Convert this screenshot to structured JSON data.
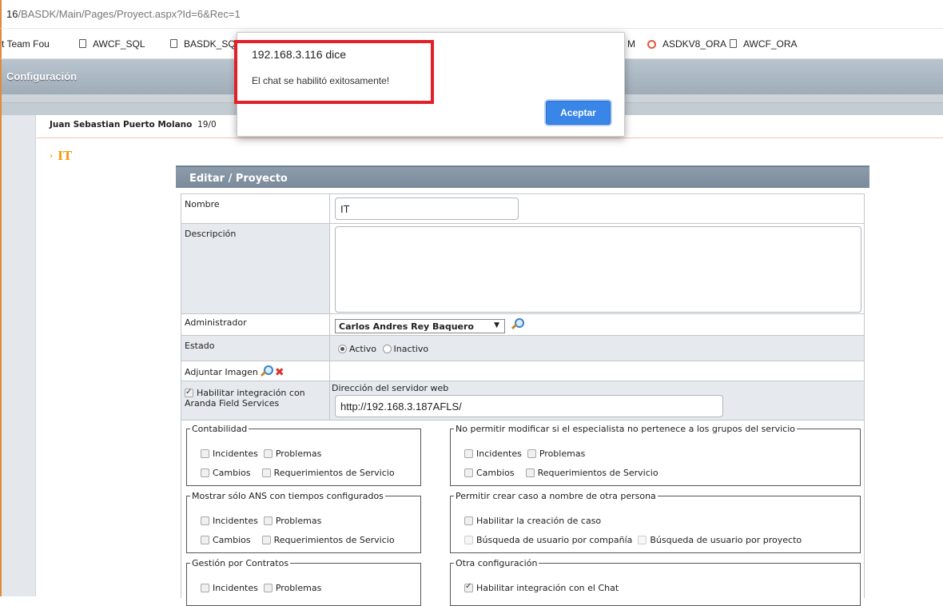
{
  "browser": {
    "url_host": "16",
    "url_path": "/BASDK/Main/Pages/Proyect.aspx?Id=6&Rec=1",
    "bookmarks": [
      {
        "label": "t Team Fou",
        "icon": "none"
      },
      {
        "label": "AWCF_SQL",
        "icon": "page-icon"
      },
      {
        "label": "BASDK_SQ",
        "icon": "page-icon"
      },
      {
        "label": "M",
        "icon": "none"
      },
      {
        "label": "ASDKV8_ORA",
        "icon": "target-icon"
      },
      {
        "label": "AWCF_ORA",
        "icon": "page-icon"
      }
    ]
  },
  "app": {
    "title": "Configuración",
    "user_name": "Juan Sebastian Puerto Molano",
    "user_date": "19/0",
    "section_title": "IT"
  },
  "form": {
    "panel_title": "Editar / Proyecto",
    "nombre_label": "Nombre",
    "nombre_value": "IT",
    "descripcion_label": "Descripción",
    "descripcion_value": "",
    "administrador_label": "Administrador",
    "administrador_value": "Carlos Andres Rey Baquero",
    "estado_label": "Estado",
    "estado_activo": "Activo",
    "estado_inactivo": "Inactivo",
    "adjuntar_label": "Adjuntar Imagen",
    "afs_label": "Habilitar integración con Aranda Field Services",
    "servidor_label": "Dirección del servidor web",
    "servidor_value": "http://192.168.3.187AFLS/",
    "groups": {
      "contabilidad": {
        "legend": "Contabilidad",
        "incidentes": "Incidentes",
        "problemas": "Problemas",
        "cambios": "Cambios",
        "requerimientos": "Requerimientos de Servicio"
      },
      "no_modificar": {
        "legend": "No permitir modificar si el especialista no pertenece a los grupos del servicio",
        "incidentes": "Incidentes",
        "problemas": "Problemas",
        "cambios": "Cambios",
        "requerimientos": "Requerimientos de Servicio"
      },
      "ans": {
        "legend": "Mostrar sólo ANS con tiempos configurados",
        "incidentes": "Incidentes",
        "problemas": "Problemas",
        "cambios": "Cambios",
        "requerimientos": "Requerimientos de Servicio"
      },
      "otra_persona": {
        "legend": "Permitir crear caso a nombre de otra persona",
        "habilitar": "Habilitar la creación de caso",
        "busq_compania": "Búsqueda de usuario por compañía",
        "busq_proyecto": "Búsqueda de usuario por proyecto"
      },
      "contratos": {
        "legend": "Gestión por Contratos",
        "incidentes": "Incidentes",
        "problemas": "Problemas"
      },
      "otra_config": {
        "legend": "Otra configuración",
        "chat": "Habilitar integración con el Chat"
      }
    }
  },
  "dialog": {
    "title": "192.168.3.116 dice",
    "message": "El chat se habilitó exitosamente!",
    "ok_label": "Aceptar"
  },
  "colors": {
    "accent_orange": "#f39c12",
    "highlight_red": "#e3202a",
    "button_blue": "#3a86e8"
  }
}
